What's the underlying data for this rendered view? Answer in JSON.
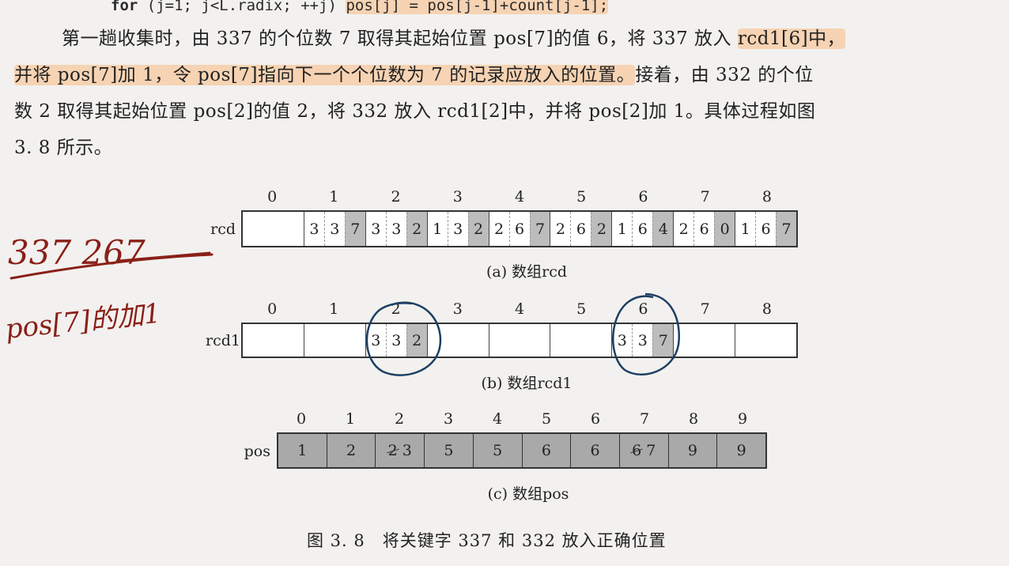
{
  "code": {
    "keyword": "for",
    "prefix": " (j=1; j<L.radix; ++j) ",
    "highlighted": "pos[j] = pos[j-1]+count[j-1];"
  },
  "paragraph": {
    "line1_a": "第一趟收集时，由 337 的个位数 7 取得其起始位置 pos[7]的值 6，将 337 放入 ",
    "line1_hl": "rcd1[6]中，",
    "line2_hl": "并将 pos[7]加 1，令 pos[7]指向下一个个位数为 7 的记录应放入的位置。",
    "line2_b": "接着，由 332 的个位",
    "line3": "数 2 取得其起始位置 pos[2]的值 2，将 332 放入 rcd1[2]中，并将 pos[2]加 1。具体过程如图",
    "line4": "3. 8 所示。"
  },
  "figure": {
    "rcd": {
      "label": "rcd",
      "indices": [
        "0",
        "1",
        "2",
        "3",
        "4",
        "5",
        "6",
        "7",
        "8"
      ],
      "cells": [
        "",
        "337",
        "332",
        "132",
        "267",
        "262",
        "164",
        "260",
        "167"
      ],
      "caption": "(a) 数组rcd"
    },
    "rcd1": {
      "label": "rcd1",
      "indices": [
        "0",
        "1",
        "2",
        "3",
        "4",
        "5",
        "6",
        "7",
        "8"
      ],
      "cells": [
        "",
        "",
        "332",
        "",
        "",
        "",
        "337",
        "",
        ""
      ],
      "caption": "(b) 数组rcd1"
    },
    "pos": {
      "label": "pos",
      "indices": [
        "0",
        "1",
        "2",
        "3",
        "4",
        "5",
        "6",
        "7",
        "8",
        "9"
      ],
      "cells": [
        {
          "old": "",
          "val": "1"
        },
        {
          "old": "",
          "val": "2"
        },
        {
          "old": "2",
          "val": "3"
        },
        {
          "old": "",
          "val": "5"
        },
        {
          "old": "",
          "val": "5"
        },
        {
          "old": "",
          "val": "6"
        },
        {
          "old": "",
          "val": "6"
        },
        {
          "old": "6",
          "val": "7"
        },
        {
          "old": "",
          "val": "9"
        },
        {
          "old": "",
          "val": "9"
        }
      ],
      "caption": "(c) 数组pos"
    },
    "caption": "图 3. 8　将关键字 337 和 332 放入正确位置"
  },
  "handwriting": {
    "left_top": "337      267",
    "left_bottom": "pos[7]的加1",
    "color": "#8a2018",
    "circle_color": "#1d3f63"
  }
}
